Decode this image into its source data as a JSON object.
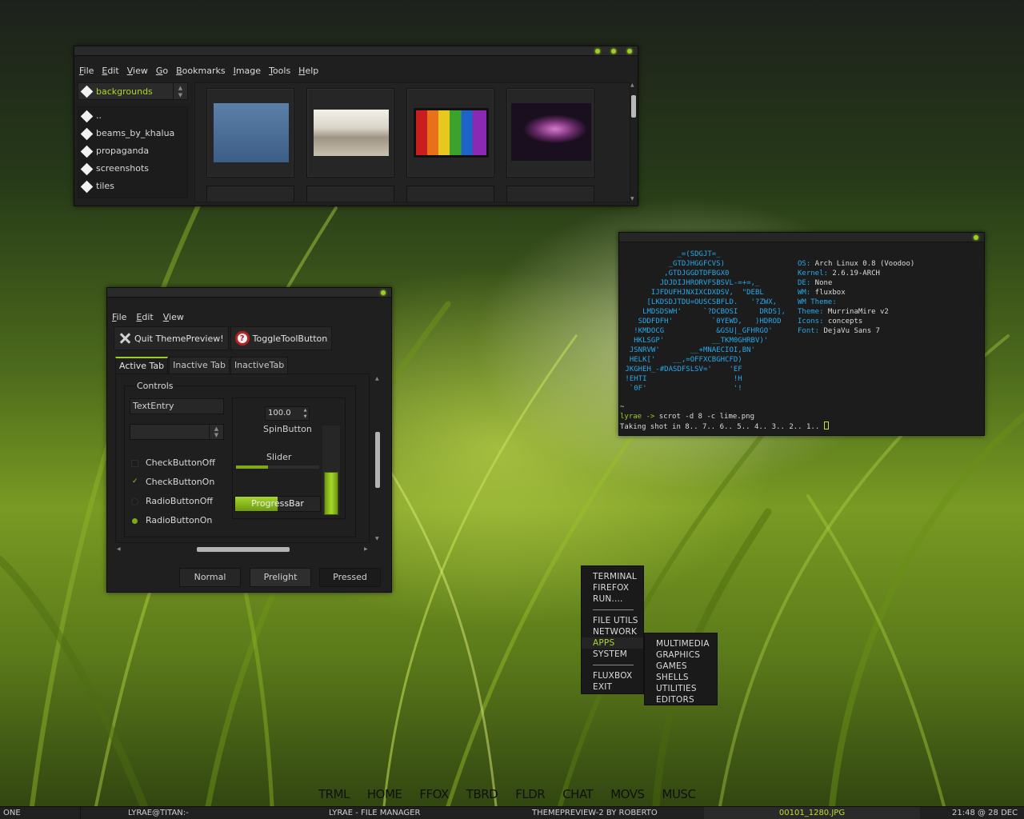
{
  "file_manager": {
    "menu": [
      "File",
      "Edit",
      "View",
      "Go",
      "Bookmarks",
      "Image",
      "Tools",
      "Help"
    ],
    "location": "backgrounds",
    "folders": [
      "..",
      "beams_by_khalua",
      "propaganda",
      "screenshots",
      "tiles"
    ]
  },
  "theme_preview": {
    "menu": [
      "File",
      "Edit",
      "View"
    ],
    "toolbar": {
      "quit": "Quit ThemePreview!",
      "toggle": "ToggleToolButton"
    },
    "tabs": [
      "Active Tab",
      "Inactive Tab",
      "InactiveTab"
    ],
    "controls": {
      "frame_label": "Controls",
      "text_entry": "TextEntry",
      "checks": [
        "CheckButtonOff",
        "CheckButtonOn",
        "RadioButtonOff",
        "RadioButtonOn"
      ],
      "spin_value": "100.0",
      "spin_label": "SpinButton",
      "slider_label": "Slider",
      "slider_value": 0.38,
      "vscale_value": 0.48,
      "progress_label": "ProgressBar",
      "progress_value": 0.5
    },
    "buttons": [
      "Normal",
      "Prelight",
      "Pressed"
    ]
  },
  "terminal": {
    "info": [
      {
        "k": "OS:",
        "v": " Arch Linux 0.8 (Voodoo)"
      },
      {
        "k": "Kernel:",
        "v": " 2.6.19-ARCH"
      },
      {
        "k": "DE:",
        "v": " None"
      },
      {
        "k": "WM:",
        "v": " fluxbox"
      },
      {
        "k": "WM Theme:",
        "v": ""
      },
      {
        "k": "Theme:",
        "v": " MurrinaMire v2"
      },
      {
        "k": "Icons:",
        "v": " concepts"
      },
      {
        "k": "Font:",
        "v": " DejaVu Sans 7"
      }
    ],
    "prompt_user": "lyrae ->",
    "command": " scrot -d 8 -c lime.png",
    "output": "Taking shot in 8.. 7.. 6.. 5.. 4.. 3.. 2.. 1.. "
  },
  "root_menu": {
    "group1": [
      "TERMINAL",
      "FIREFOX",
      "RUN...."
    ],
    "group2": [
      "FILE UTILS",
      "NETWORK",
      "APPS",
      "SYSTEM"
    ],
    "group3": [
      "FLUXBOX",
      "EXIT"
    ],
    "active": "APPS"
  },
  "apps_submenu": [
    "MULTIMEDIA",
    "GRAPHICS",
    "GAMES",
    "SHELLS",
    "UTILITIES",
    "EDITORS"
  ],
  "launcher": [
    "TRML",
    "HOME",
    "FFOX",
    "TBRD",
    "FLDR",
    "CHAT",
    "MOVS",
    "MUSC"
  ],
  "taskbar": {
    "workspace": "ONE",
    "tasks": [
      "LYRAE@TITAN:-",
      "LYRAE - FILE MANAGER",
      "THEMEPREVIEW-2 BY ROBERTO",
      "00101_1280.JPG"
    ],
    "clock": "21:48 @ 28 DEC"
  },
  "colors": {
    "accent": "#9ccf22",
    "terminal_blue": "#2aa8e8",
    "window_bg": "#1f1f1f"
  }
}
